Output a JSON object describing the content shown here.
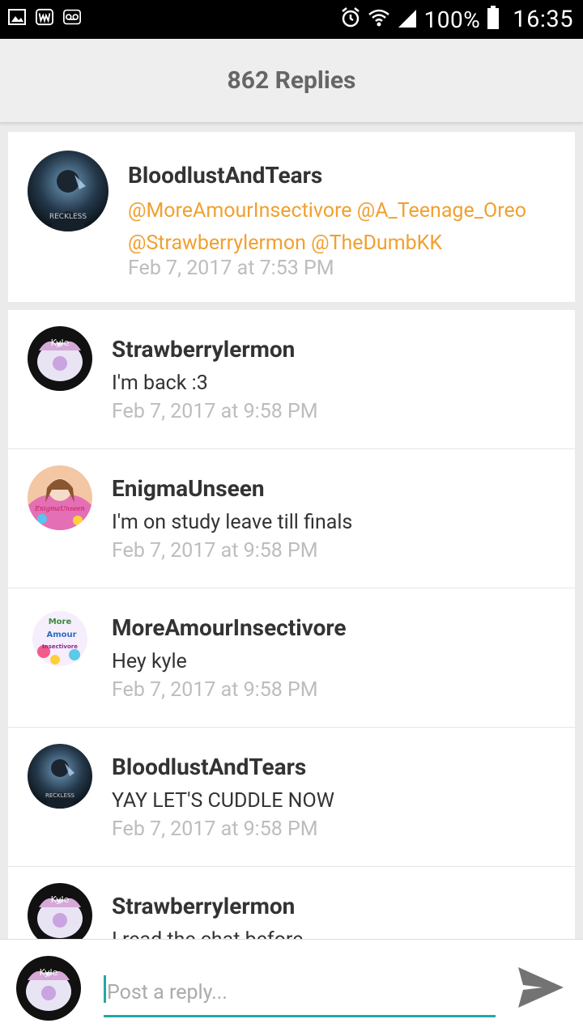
{
  "status_bar": {
    "battery": "100%",
    "time": "16:35"
  },
  "header": {
    "title": "862 Replies"
  },
  "original_post": {
    "username": "BloodlustAndTears",
    "mentions_line1": "@MoreAmourInsectivore @A_Teenage_Oreo",
    "mentions_line2": "@Strawberrylermon @TheDumbKK",
    "date": "Feb 7, 2017 at 7:53 PM",
    "avatar_text": "RECKLESS"
  },
  "replies": [
    {
      "username": "Strawberrylermon",
      "message": "I'm back :3",
      "date": "Feb 7, 2017 at 9:58 PM",
      "avatar_text": "Kyle"
    },
    {
      "username": "EnigmaUnseen",
      "message": "I'm on study leave till finals",
      "date": "Feb 7, 2017 at 9:58 PM",
      "avatar_text": "EnigmaUnseen"
    },
    {
      "username": "MoreAmourInsectivore",
      "message": "Hey kyle",
      "date": "Feb 7, 2017 at 9:58 PM",
      "avatar_text": "More Amour Insectivore"
    },
    {
      "username": "BloodlustAndTears",
      "message": "YAY LET'S CUDDLE NOW",
      "date": "Feb 7, 2017 at 9:58 PM",
      "avatar_text": "RECKLESS"
    },
    {
      "username": "Strawberrylermon",
      "message": "I read the chat before",
      "date": "",
      "avatar_text": "Kyle"
    }
  ],
  "composer": {
    "placeholder": "Post a reply...",
    "avatar_text": "Kyle"
  },
  "colors": {
    "mention": "#f0a030",
    "accent": "#26a6a6",
    "date": "#bdbdbd"
  }
}
